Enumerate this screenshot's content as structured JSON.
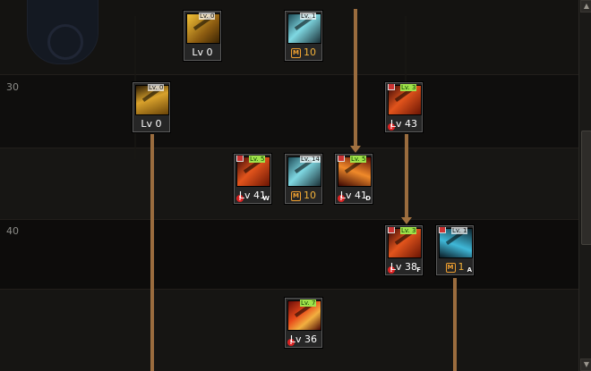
{
  "level_markers": [
    {
      "label": "30"
    },
    {
      "label": "40"
    }
  ],
  "skills": [
    {
      "id": "s1",
      "level_text": "Lv 0",
      "top_tag": "Lv. 0",
      "style": "i-yellow"
    },
    {
      "id": "s2",
      "mastery_value": "10",
      "top_tag": "Lv. 1",
      "style": "i-cyan",
      "mastery": true
    },
    {
      "id": "s3",
      "level_text": "Lv 0",
      "top_tag": "Lv. 0",
      "style": "i-yellow2"
    },
    {
      "id": "s4",
      "level_text": "Lv 43",
      "top_tag": "Lv. 3",
      "style": "i-red",
      "locked": true,
      "warn": true
    },
    {
      "id": "s5",
      "level_text": "Lv 41",
      "top_tag": "Lv. 5",
      "style": "i-red",
      "locked": true,
      "warn": true,
      "badge": "W"
    },
    {
      "id": "s6",
      "mastery_value": "10",
      "top_tag": "Lv. 14",
      "style": "i-cyan",
      "mastery": true
    },
    {
      "id": "s7",
      "level_text": "Lv 41",
      "top_tag": "Lv. 5",
      "style": "i-red2",
      "locked": true,
      "warn": true,
      "badge": "D"
    },
    {
      "id": "s8",
      "level_text": "Lv 38",
      "top_tag": "Lv. 3",
      "style": "i-red",
      "locked": true,
      "warn": true,
      "badge": "F"
    },
    {
      "id": "s9",
      "mastery_value": "1",
      "top_tag": "Lv. 1",
      "style": "i-cyan2",
      "mastery": true,
      "locked": true,
      "badge": "A"
    },
    {
      "id": "s10",
      "level_text": "Lv 36",
      "top_tag": "Lv. 7",
      "style": "i-red3",
      "warn": true
    }
  ],
  "mastery_icon": "M",
  "scrollbar": {
    "up_icon": "chevron-up-icon",
    "down_icon": "chevron-down-icon",
    "up_glyph": "▲",
    "down_glyph": "▼"
  }
}
